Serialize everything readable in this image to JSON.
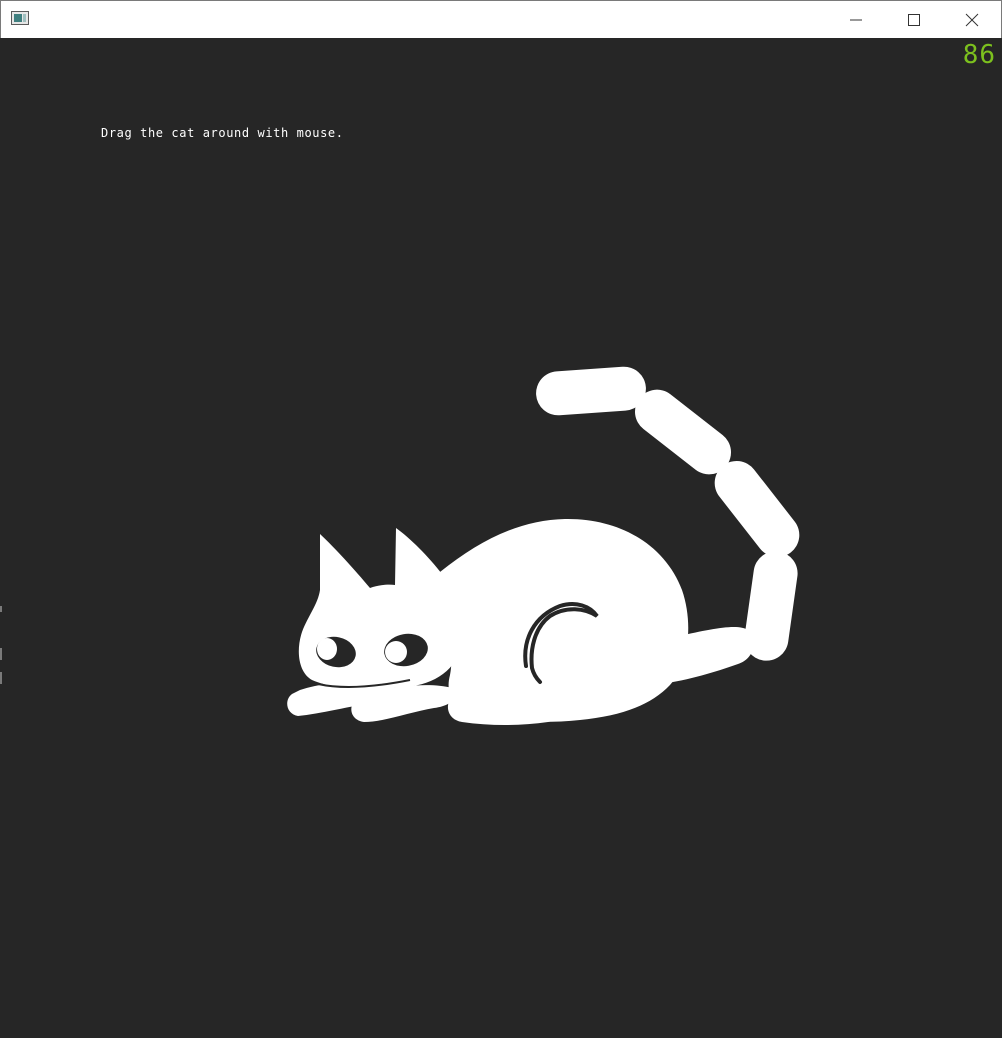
{
  "window": {
    "title": "",
    "icon": "app-window-icon",
    "controls": {
      "minimize_icon": "minimize-icon",
      "maximize_icon": "maximize-icon",
      "close_icon": "close-icon"
    }
  },
  "overlay": {
    "fps": "86",
    "fps_color": "#7cc01e"
  },
  "scene": {
    "instruction": "Drag the cat around with mouse.",
    "background": "#262626",
    "cat_color": "#ffffff",
    "eye_color": "#262626"
  }
}
